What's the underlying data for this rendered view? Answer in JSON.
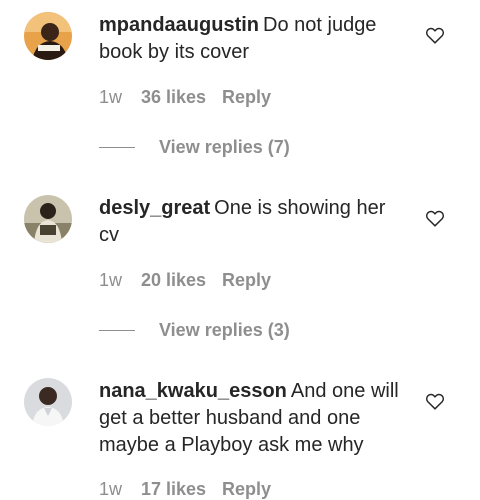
{
  "colors": {
    "text": "#262626",
    "muted": "#8e8e8e",
    "background": "#ffffff"
  },
  "comments": [
    {
      "username": "mpandaaugustin",
      "text": "Do not judge book by its cover",
      "time": "1w",
      "likes": "36 likes",
      "reply_label": "Reply",
      "view_replies": "View replies (7)",
      "like_icon": "heart-outline-icon"
    },
    {
      "username": "desly_great",
      "text": "One is showing her cv",
      "time": "1w",
      "likes": "20 likes",
      "reply_label": "Reply",
      "view_replies": "View replies (3)",
      "like_icon": "heart-outline-icon"
    },
    {
      "username": "nana_kwaku_esson",
      "text": "And one will get a better husband and one maybe a Playboy ask me why",
      "time": "1w",
      "likes": "17 likes",
      "reply_label": "Reply",
      "like_icon": "heart-outline-icon"
    }
  ]
}
